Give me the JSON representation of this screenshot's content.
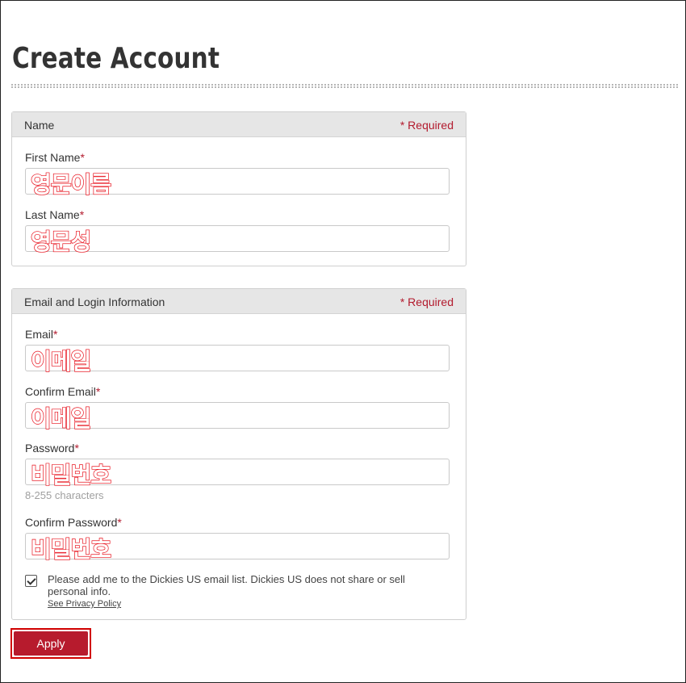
{
  "page": {
    "title": "Create Account"
  },
  "name_section": {
    "title": "Name",
    "required_label": "* Required",
    "first_name": {
      "label": "First Name",
      "star": "*",
      "value": "영문이름"
    },
    "last_name": {
      "label": "Last Name",
      "star": "*",
      "value": "영문성"
    }
  },
  "login_section": {
    "title": "Email and Login Information",
    "required_label": "* Required",
    "email": {
      "label": "Email",
      "star": "*",
      "value": "이메일"
    },
    "confirm_email": {
      "label": "Confirm Email",
      "star": "*",
      "value": "이메일"
    },
    "password": {
      "label": "Password",
      "star": "*",
      "value": "비밀번호",
      "hint": "8-255 characters"
    },
    "confirm_password": {
      "label": "Confirm Password",
      "star": "*",
      "value": "비밀번호"
    },
    "newsletter": {
      "checked": true,
      "text": "Please add me to the Dickies US email list. Dickies US does not share or sell personal info.",
      "link": "See Privacy Policy"
    }
  },
  "actions": {
    "apply_label": "Apply"
  },
  "colors": {
    "accent": "#b71b2d",
    "required": "#b31b2e",
    "annotation": "#e8141f"
  }
}
